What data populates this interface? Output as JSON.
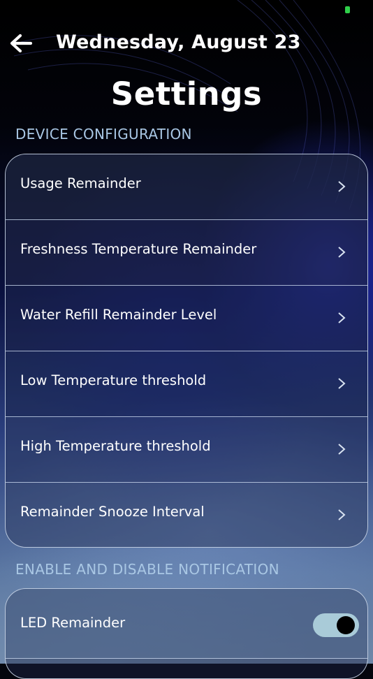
{
  "header": {
    "back_icon": "arrow-left-icon",
    "date": "Wednesday, August 23"
  },
  "page": {
    "title": "Settings"
  },
  "device_configuration": {
    "section_title": "DEVICE CONFIGURATION",
    "chevron_icon": "chevron-right-icon",
    "items": [
      {
        "label": "Usage Remainder"
      },
      {
        "label": "Freshness Temperature Remainder"
      },
      {
        "label": "Water Refill Remainder Level"
      },
      {
        "label": "Low Temperature threshold"
      },
      {
        "label": "High Temperature threshold"
      },
      {
        "label": "Remainder Snooze Interval"
      }
    ]
  },
  "notifications": {
    "section_title": "ENABLE AND DISABLE NOTIFICATION",
    "items": [
      {
        "label": "LED Remainder",
        "enabled": true
      }
    ]
  },
  "colors": {
    "section_title": "#a9c7e4",
    "toggle_track_on": "#a9cbd8",
    "toggle_knob": "#000000",
    "status_indicator": "#2fcf4a"
  }
}
